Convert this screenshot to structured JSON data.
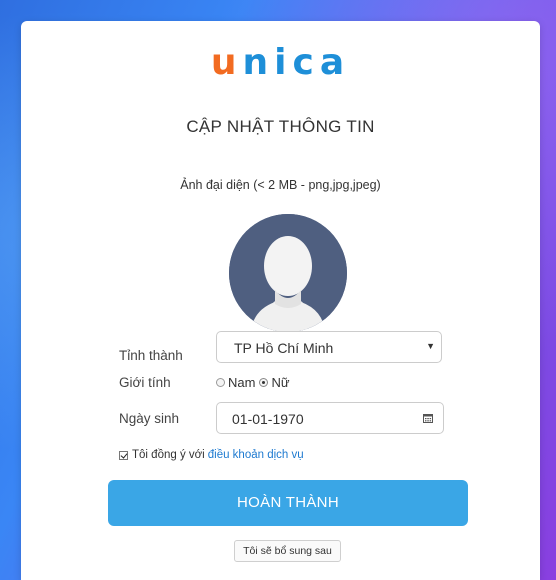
{
  "brand": {
    "logo_first": "u",
    "logo_rest": "nica",
    "colors": {
      "accent_orange": "#f26b21",
      "accent_blue": "#1e8fd8",
      "button_blue": "#3aa6e6"
    }
  },
  "page_title": "CẬP NHẬT THÔNG TIN",
  "avatar": {
    "label": "Ảnh đại diện (< 2 MB - png,jpg,jpeg)",
    "icon": "default-user-avatar-icon"
  },
  "form": {
    "province": {
      "label": "Tỉnh thành",
      "value": "TP Hồ Chí Minh",
      "caret": "▼"
    },
    "gender": {
      "label": "Giới tính",
      "options": [
        {
          "label": "Nam",
          "checked": false
        },
        {
          "label": "Nữ",
          "checked": true
        }
      ]
    },
    "birthday": {
      "label": "Ngày sinh",
      "value": "01-01-1970",
      "icon": "calendar-icon"
    },
    "agree": {
      "checked": true,
      "text": "Tôi đồng ý với",
      "link_text": "điều khoản dịch vụ"
    }
  },
  "buttons": {
    "submit_label": "HOÀN THÀNH",
    "later_label": "Tôi sẽ bổ sung sau"
  }
}
